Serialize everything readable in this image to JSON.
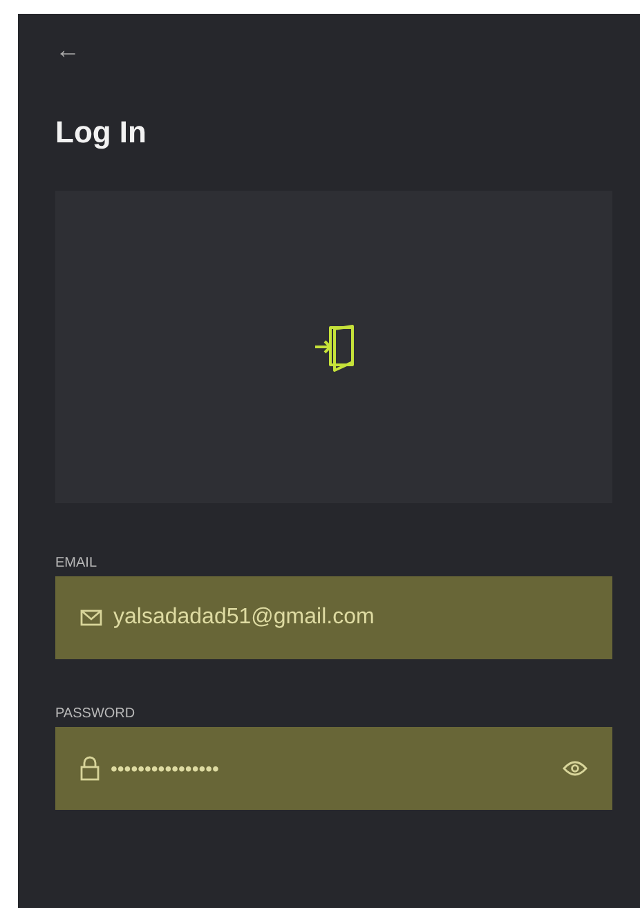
{
  "header": {
    "back_symbol": "←",
    "title": "Log In"
  },
  "fields": [
    {
      "kind": "email",
      "label": "EMAIL",
      "value": "yalsadadad51@gmail.com"
    },
    {
      "kind": "password",
      "label": "PASSWORD",
      "value": "••••••••••••••••"
    }
  ]
}
